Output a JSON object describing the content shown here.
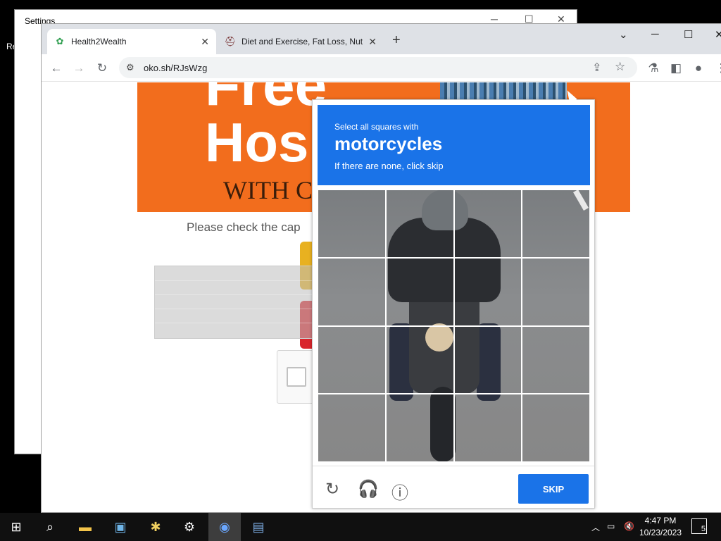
{
  "desktop": {
    "label_partial": "Re"
  },
  "settings_window": {
    "title": "Settings"
  },
  "browser": {
    "tabs": [
      {
        "label": "Health2Wealth",
        "active": true,
        "icon": "health2wealth-favicon"
      },
      {
        "label": "Diet and Exercise, Fat Loss, Nutri",
        "active": false,
        "icon": "spartan-helmet-favicon"
      }
    ],
    "url": "oko.sh/RJsWzg"
  },
  "page": {
    "banner_line1": "Free",
    "banner_line2": "Hos",
    "banner_line3": "WITH C",
    "check_prompt": "Please check the cap"
  },
  "captcha": {
    "instruction": "Select all squares with",
    "target": "motorcycles",
    "fallback": "If there are none, click skip",
    "skip_label": "SKIP",
    "accent": "#1a73e8"
  },
  "taskbar": {
    "time": "4:47 PM",
    "date": "10/23/2023",
    "notification_count": "5"
  }
}
